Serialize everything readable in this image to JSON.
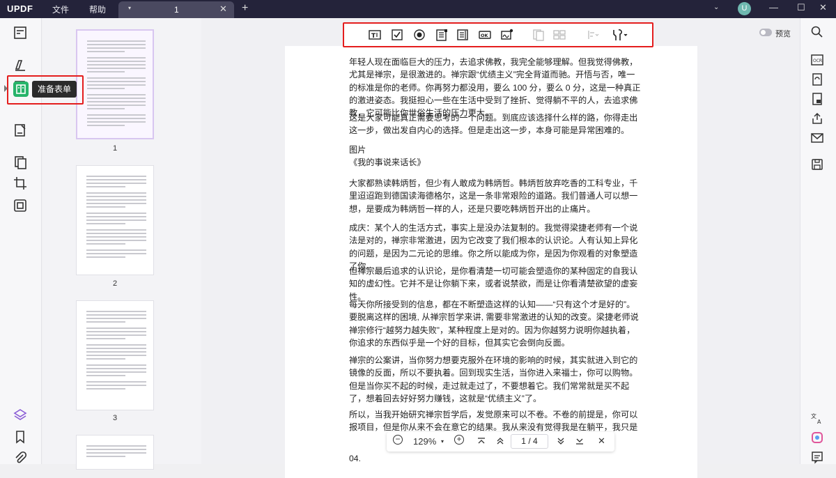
{
  "app": {
    "logo": "UPDF",
    "menu": [
      "文件",
      "帮助"
    ],
    "avatar_letter": "U"
  },
  "tab": {
    "title": "1",
    "caret": "▾",
    "close": "✕",
    "add": "+"
  },
  "window_controls": {
    "chevron": "⌄",
    "minimize": "—",
    "maximize": "☐",
    "close": "✕"
  },
  "sidebar": {
    "active_tooltip": "准备表单"
  },
  "thumbnails": [
    {
      "num": "1"
    },
    {
      "num": "2"
    },
    {
      "num": "3"
    }
  ],
  "toolbar": {
    "preview_label": "预览"
  },
  "document": {
    "paragraphs": [
      "年轻人现在面临巨大的压力，去追求佛教，我完全能够理解。但我觉得佛教，尤其是禅宗，是很激进的。禅宗跟“优绩主义”完全背道而驰。开悟与否，唯一的标准是你的老师。你再努力都没用，要么 100 分，要么 0 分，这是一种真正的激进姿态。我挺担心一些在生活中受到了挫折、觉得躺不平的人，去追求佛教，它可能比你世俗生活的压力更大。",
      "这是大家可能真正需要思考的一个问题。到底应该选择什么样的路，你得走出这一步，做出发自内心的选择。但是走出这一步，本身可能是异常困难的。",
      "图片",
      "《我的事说来话长》",
      "大家都熟读韩炳哲，但少有人敢成为韩炳哲。韩炳哲放弃吃香的工科专业，千里迢迢跑到德国读海德格尔，这是一条非常艰险的道路。我们普通人可以想一想，是要成为韩炳哲一样的人，还是只要吃韩炳哲开出的止痛片。",
      "成庆：某个人的生活方式，事实上是没办法复制的。我觉得梁捷老师有一个说法是对的，禅宗非常激进，因为它改变了我们根本的认识论。人有认知上异化的问题，是因为二元论的思维。你之所以能成为你，是因为你观看的对象塑造了你。",
      "但禅宗最后追求的认识论，是你看清楚一切可能会塑造你的某种固定的自我认知的虚幻性。它并不是让你躺下来，或者说禁欲，而是让你看清楚欲望的虚妄性。",
      "每天你所接受到的信息，都在不断塑造这样的认知——“只有这个才是好的”。要脱离这样的困境, 从禅宗哲学来讲, 需要非常激进的认知的改变。梁捷老师说禅宗修行“越努力越失败”，某种程度上是对的。因为你越努力说明你越执着，你追求的东西似乎是一个好的目标，但其实它会倒向反面。",
      "禅宗的公案讲，当你努力想要克服外在环境的影响的时候，其实就进入到它的镜像的反面，所以不要执着。回到现实生活，当你进入来福士，你可以购物。但是当你买不起的时候，走过就走过了，不要想着它。我们常常就是买不起了，想着回去好好努力赚钱，这就是“优绩主义”了。",
      "所以，当我开始研究禅宗哲学后，发觉原来可以不卷。不卷的前提是，你可以报项目，但是你从来不会在意它的结果。我从来没有觉得我是在躺平，我只是在找自己的生活节奏。这个大的社会运行",
      "04."
    ]
  },
  "pagenav": {
    "zoom_out": "−",
    "zoom": "129%",
    "zoom_caret": "▾",
    "zoom_in": "+",
    "current_page": "1",
    "separator": "/",
    "total_pages": "4",
    "close": "✕"
  },
  "colors": {
    "titlebar": "#24233a",
    "highlight_border": "#e41d1d",
    "active_green": "#27b36a"
  }
}
